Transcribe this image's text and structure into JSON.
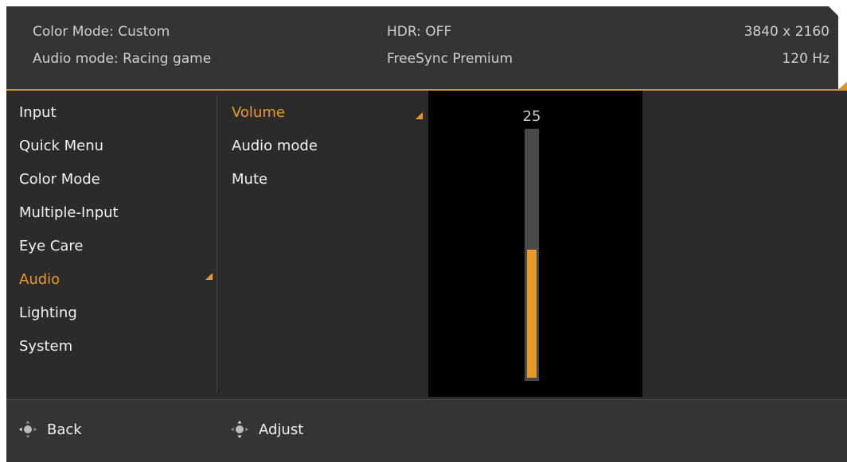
{
  "header": {
    "color_mode": "Color Mode: Custom",
    "audio_mode": "Audio mode: Racing game",
    "hdr": "HDR: OFF",
    "freesync": "FreeSync Premium",
    "resolution": "3840 x 2160",
    "refresh": "120 Hz"
  },
  "menu": {
    "items": [
      "Input",
      "Quick Menu",
      "Color Mode",
      "Multiple-Input",
      "Eye Care",
      "Audio",
      "Lighting",
      "System"
    ],
    "active": "Audio"
  },
  "submenu": {
    "items": [
      "Volume",
      "Audio mode",
      "Mute"
    ],
    "active": "Volume"
  },
  "volume": {
    "value_label": "25",
    "level": 0.52
  },
  "footer": {
    "back_label": "Back",
    "adjust_label": "Adjust",
    "icon": "joystick-icon"
  },
  "colors": {
    "accent": "#e79a2b",
    "panel": "#2c2b29",
    "header": "#363432",
    "slider_bg": "#000000"
  }
}
